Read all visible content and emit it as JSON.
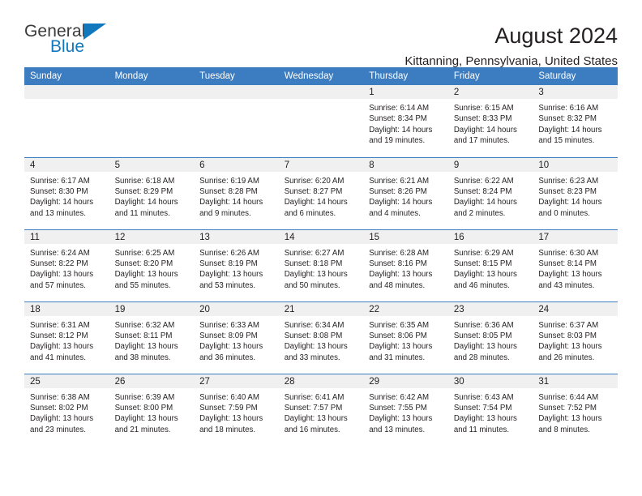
{
  "brand": {
    "name_top": "General",
    "name_bottom": "Blue",
    "logo_icon": "triangle-flag-icon",
    "accent_color": "#1278be"
  },
  "header": {
    "title": "August 2024",
    "subtitle": "Kittanning, Pennsylvania, United States"
  },
  "calendar": {
    "header_bg": "#3c7cc0",
    "daynum_bg": "#f0f0f0",
    "weekdays": [
      "Sunday",
      "Monday",
      "Tuesday",
      "Wednesday",
      "Thursday",
      "Friday",
      "Saturday"
    ],
    "weeks": [
      [
        {
          "day": "",
          "empty": true
        },
        {
          "day": "",
          "empty": true
        },
        {
          "day": "",
          "empty": true
        },
        {
          "day": "",
          "empty": true
        },
        {
          "day": "1",
          "sunrise": "Sunrise: 6:14 AM",
          "sunset": "Sunset: 8:34 PM",
          "daylight1": "Daylight: 14 hours",
          "daylight2": "and 19 minutes."
        },
        {
          "day": "2",
          "sunrise": "Sunrise: 6:15 AM",
          "sunset": "Sunset: 8:33 PM",
          "daylight1": "Daylight: 14 hours",
          "daylight2": "and 17 minutes."
        },
        {
          "day": "3",
          "sunrise": "Sunrise: 6:16 AM",
          "sunset": "Sunset: 8:32 PM",
          "daylight1": "Daylight: 14 hours",
          "daylight2": "and 15 minutes."
        }
      ],
      [
        {
          "day": "4",
          "sunrise": "Sunrise: 6:17 AM",
          "sunset": "Sunset: 8:30 PM",
          "daylight1": "Daylight: 14 hours",
          "daylight2": "and 13 minutes."
        },
        {
          "day": "5",
          "sunrise": "Sunrise: 6:18 AM",
          "sunset": "Sunset: 8:29 PM",
          "daylight1": "Daylight: 14 hours",
          "daylight2": "and 11 minutes."
        },
        {
          "day": "6",
          "sunrise": "Sunrise: 6:19 AM",
          "sunset": "Sunset: 8:28 PM",
          "daylight1": "Daylight: 14 hours",
          "daylight2": "and 9 minutes."
        },
        {
          "day": "7",
          "sunrise": "Sunrise: 6:20 AM",
          "sunset": "Sunset: 8:27 PM",
          "daylight1": "Daylight: 14 hours",
          "daylight2": "and 6 minutes."
        },
        {
          "day": "8",
          "sunrise": "Sunrise: 6:21 AM",
          "sunset": "Sunset: 8:26 PM",
          "daylight1": "Daylight: 14 hours",
          "daylight2": "and 4 minutes."
        },
        {
          "day": "9",
          "sunrise": "Sunrise: 6:22 AM",
          "sunset": "Sunset: 8:24 PM",
          "daylight1": "Daylight: 14 hours",
          "daylight2": "and 2 minutes."
        },
        {
          "day": "10",
          "sunrise": "Sunrise: 6:23 AM",
          "sunset": "Sunset: 8:23 PM",
          "daylight1": "Daylight: 14 hours",
          "daylight2": "and 0 minutes."
        }
      ],
      [
        {
          "day": "11",
          "sunrise": "Sunrise: 6:24 AM",
          "sunset": "Sunset: 8:22 PM",
          "daylight1": "Daylight: 13 hours",
          "daylight2": "and 57 minutes."
        },
        {
          "day": "12",
          "sunrise": "Sunrise: 6:25 AM",
          "sunset": "Sunset: 8:20 PM",
          "daylight1": "Daylight: 13 hours",
          "daylight2": "and 55 minutes."
        },
        {
          "day": "13",
          "sunrise": "Sunrise: 6:26 AM",
          "sunset": "Sunset: 8:19 PM",
          "daylight1": "Daylight: 13 hours",
          "daylight2": "and 53 minutes."
        },
        {
          "day": "14",
          "sunrise": "Sunrise: 6:27 AM",
          "sunset": "Sunset: 8:18 PM",
          "daylight1": "Daylight: 13 hours",
          "daylight2": "and 50 minutes."
        },
        {
          "day": "15",
          "sunrise": "Sunrise: 6:28 AM",
          "sunset": "Sunset: 8:16 PM",
          "daylight1": "Daylight: 13 hours",
          "daylight2": "and 48 minutes."
        },
        {
          "day": "16",
          "sunrise": "Sunrise: 6:29 AM",
          "sunset": "Sunset: 8:15 PM",
          "daylight1": "Daylight: 13 hours",
          "daylight2": "and 46 minutes."
        },
        {
          "day": "17",
          "sunrise": "Sunrise: 6:30 AM",
          "sunset": "Sunset: 8:14 PM",
          "daylight1": "Daylight: 13 hours",
          "daylight2": "and 43 minutes."
        }
      ],
      [
        {
          "day": "18",
          "sunrise": "Sunrise: 6:31 AM",
          "sunset": "Sunset: 8:12 PM",
          "daylight1": "Daylight: 13 hours",
          "daylight2": "and 41 minutes."
        },
        {
          "day": "19",
          "sunrise": "Sunrise: 6:32 AM",
          "sunset": "Sunset: 8:11 PM",
          "daylight1": "Daylight: 13 hours",
          "daylight2": "and 38 minutes."
        },
        {
          "day": "20",
          "sunrise": "Sunrise: 6:33 AM",
          "sunset": "Sunset: 8:09 PM",
          "daylight1": "Daylight: 13 hours",
          "daylight2": "and 36 minutes."
        },
        {
          "day": "21",
          "sunrise": "Sunrise: 6:34 AM",
          "sunset": "Sunset: 8:08 PM",
          "daylight1": "Daylight: 13 hours",
          "daylight2": "and 33 minutes."
        },
        {
          "day": "22",
          "sunrise": "Sunrise: 6:35 AM",
          "sunset": "Sunset: 8:06 PM",
          "daylight1": "Daylight: 13 hours",
          "daylight2": "and 31 minutes."
        },
        {
          "day": "23",
          "sunrise": "Sunrise: 6:36 AM",
          "sunset": "Sunset: 8:05 PM",
          "daylight1": "Daylight: 13 hours",
          "daylight2": "and 28 minutes."
        },
        {
          "day": "24",
          "sunrise": "Sunrise: 6:37 AM",
          "sunset": "Sunset: 8:03 PM",
          "daylight1": "Daylight: 13 hours",
          "daylight2": "and 26 minutes."
        }
      ],
      [
        {
          "day": "25",
          "sunrise": "Sunrise: 6:38 AM",
          "sunset": "Sunset: 8:02 PM",
          "daylight1": "Daylight: 13 hours",
          "daylight2": "and 23 minutes."
        },
        {
          "day": "26",
          "sunrise": "Sunrise: 6:39 AM",
          "sunset": "Sunset: 8:00 PM",
          "daylight1": "Daylight: 13 hours",
          "daylight2": "and 21 minutes."
        },
        {
          "day": "27",
          "sunrise": "Sunrise: 6:40 AM",
          "sunset": "Sunset: 7:59 PM",
          "daylight1": "Daylight: 13 hours",
          "daylight2": "and 18 minutes."
        },
        {
          "day": "28",
          "sunrise": "Sunrise: 6:41 AM",
          "sunset": "Sunset: 7:57 PM",
          "daylight1": "Daylight: 13 hours",
          "daylight2": "and 16 minutes."
        },
        {
          "day": "29",
          "sunrise": "Sunrise: 6:42 AM",
          "sunset": "Sunset: 7:55 PM",
          "daylight1": "Daylight: 13 hours",
          "daylight2": "and 13 minutes."
        },
        {
          "day": "30",
          "sunrise": "Sunrise: 6:43 AM",
          "sunset": "Sunset: 7:54 PM",
          "daylight1": "Daylight: 13 hours",
          "daylight2": "and 11 minutes."
        },
        {
          "day": "31",
          "sunrise": "Sunrise: 6:44 AM",
          "sunset": "Sunset: 7:52 PM",
          "daylight1": "Daylight: 13 hours",
          "daylight2": "and 8 minutes."
        }
      ]
    ]
  }
}
